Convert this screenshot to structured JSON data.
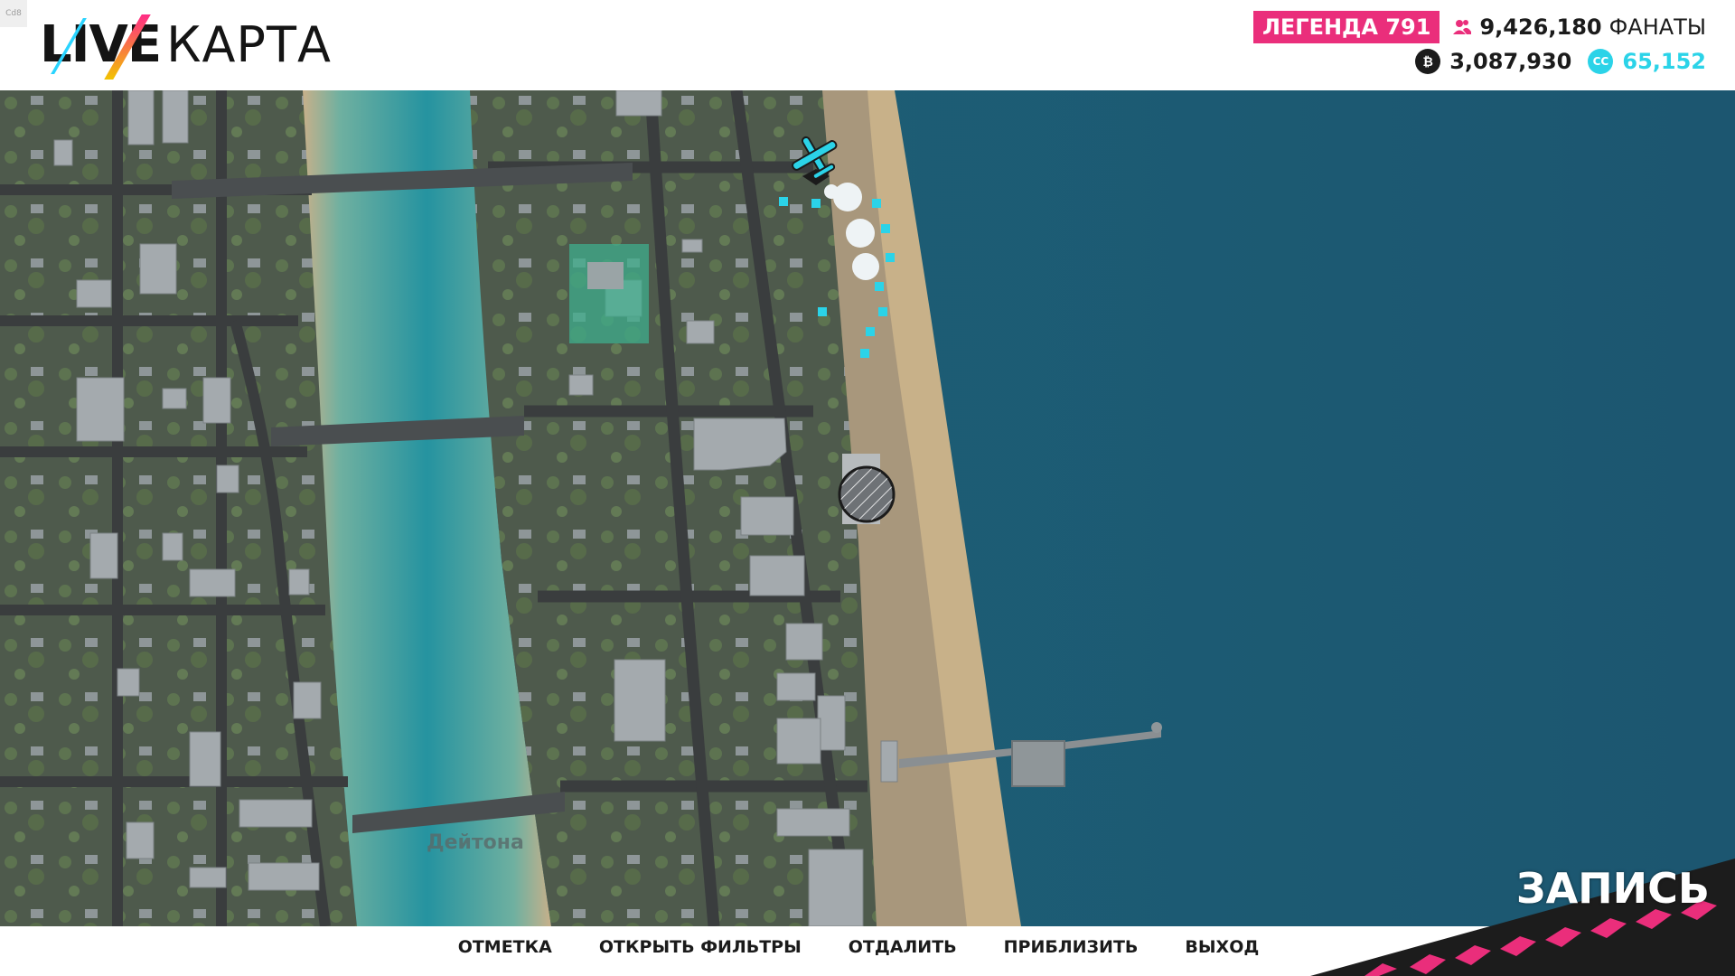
{
  "corner": {
    "tag": "Cd8"
  },
  "logo": {
    "live": "LIVE",
    "map": "КАРТА"
  },
  "player": {
    "legend": "ЛЕГЕНДА 791",
    "fans_count": "9,426,180",
    "fans_label": "ФАНАТЫ",
    "credits": "3,087,930",
    "skill_points": "65,152"
  },
  "map": {
    "town_label": "Дейтона",
    "marker_icon": "plane-icon"
  },
  "controls": {
    "mark": "ОТМЕТКА",
    "filters": "ОТКРЫТЬ ФИЛЬТРЫ",
    "zoom_out": "ОТДАЛИТЬ",
    "zoom_in": "ПРИБЛИЗИТЬ",
    "exit": "ВЫХОД"
  },
  "record": {
    "label": "ЗАПИСЬ"
  },
  "colors": {
    "accent": "#ea2e7b",
    "skill": "#2bd3e8",
    "ocean": "#1d5a70",
    "lagoon": "#2c9aa0",
    "sand": "#c9b18c"
  }
}
